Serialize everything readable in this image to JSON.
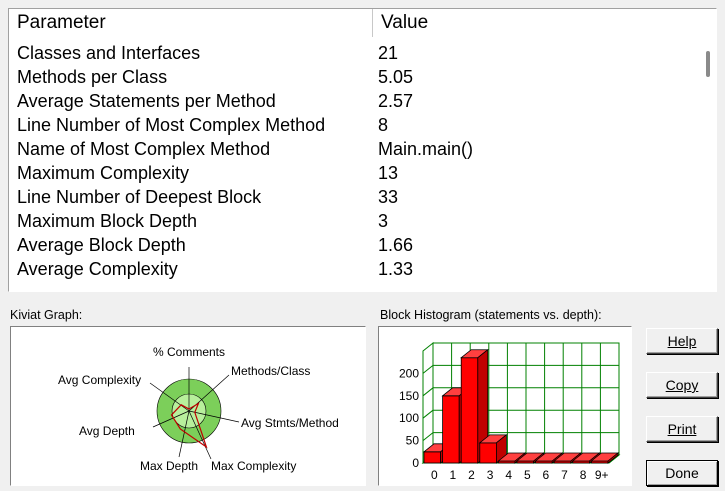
{
  "table": {
    "headers": {
      "parameter": "Parameter",
      "value": "Value"
    },
    "rows": [
      {
        "parameter": "Classes and Interfaces",
        "value": "21"
      },
      {
        "parameter": "Methods per Class",
        "value": "5.05"
      },
      {
        "parameter": "Average Statements per Method",
        "value": "2.57"
      },
      {
        "parameter": "Line Number of Most Complex Method",
        "value": "8"
      },
      {
        "parameter": "Name of Most Complex Method",
        "value": "Main.main()"
      },
      {
        "parameter": "Maximum Complexity",
        "value": "13"
      },
      {
        "parameter": "Line Number of Deepest Block",
        "value": "33"
      },
      {
        "parameter": "Maximum Block Depth",
        "value": "3"
      },
      {
        "parameter": "Average Block Depth",
        "value": "1.66"
      },
      {
        "parameter": "Average Complexity",
        "value": "1.33"
      }
    ]
  },
  "kiviat": {
    "title": "Kiviat Graph:",
    "axes": [
      "% Comments",
      "Methods/Class",
      "Avg Stmts/Method",
      "Max Complexity",
      "Max Depth",
      "Avg Depth",
      "Avg Complexity"
    ],
    "values": [
      0.05,
      0.3,
      0.15,
      1.0,
      0.5,
      0.45,
      0.25
    ],
    "ring_outer_color": "#7ccf5a",
    "ring_inner_color": "#b8ef9c",
    "polygon_color": "#c00000"
  },
  "histogram": {
    "title": "Block Histogram (statements vs. depth):",
    "chart_data": {
      "type": "bar",
      "categories": [
        "0",
        "1",
        "2",
        "3",
        "4",
        "5",
        "6",
        "7",
        "8",
        "9+"
      ],
      "values": [
        25,
        150,
        235,
        45,
        0,
        0,
        0,
        0,
        0,
        0
      ],
      "ylim": [
        0,
        250
      ],
      "yticks": [
        0,
        50,
        100,
        150,
        200
      ],
      "bar_color": "#ff0000",
      "grid_color": "#008000"
    }
  },
  "buttons": {
    "help": "Help",
    "copy": "Copy",
    "print": "Print",
    "done": "Done"
  }
}
